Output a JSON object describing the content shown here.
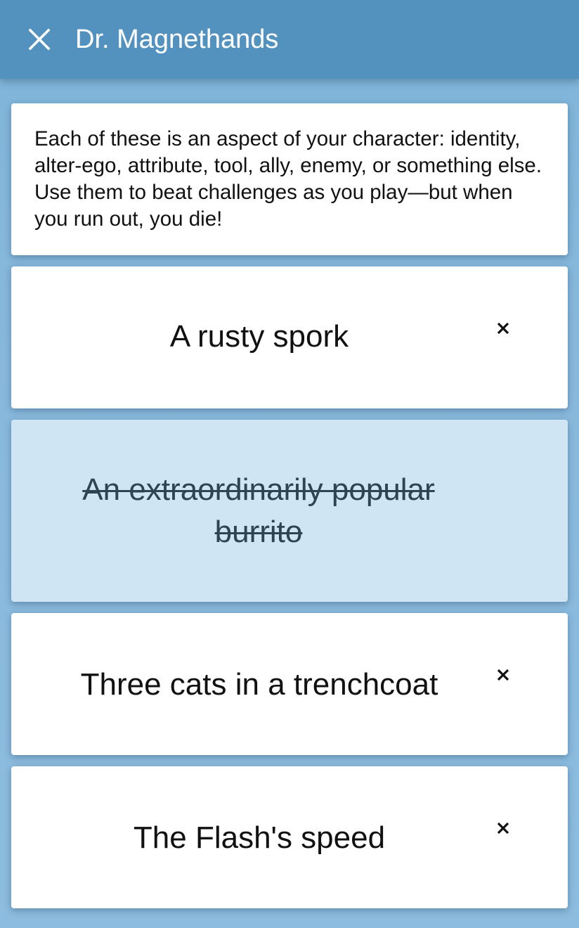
{
  "header": {
    "title": "Dr. Magnethands",
    "close_icon": "close-icon"
  },
  "intro": {
    "text": "Each of these is an aspect of your character: identity, alter-ego, attribute, tool, ally, enemy, or something else. Use them to beat challenges as you play—but when you run out, you die!"
  },
  "aspects": [
    {
      "label": "A rusty spork",
      "used": false
    },
    {
      "label": "An extraordinarily popular burrito",
      "used": true
    },
    {
      "label": "Three cats in a trenchcoat",
      "used": false
    },
    {
      "label": "The Flash's speed",
      "used": false
    }
  ],
  "colors": {
    "appbar": "#5392bf",
    "background": "#88b9dd",
    "used_card": "#d0e5f3"
  }
}
